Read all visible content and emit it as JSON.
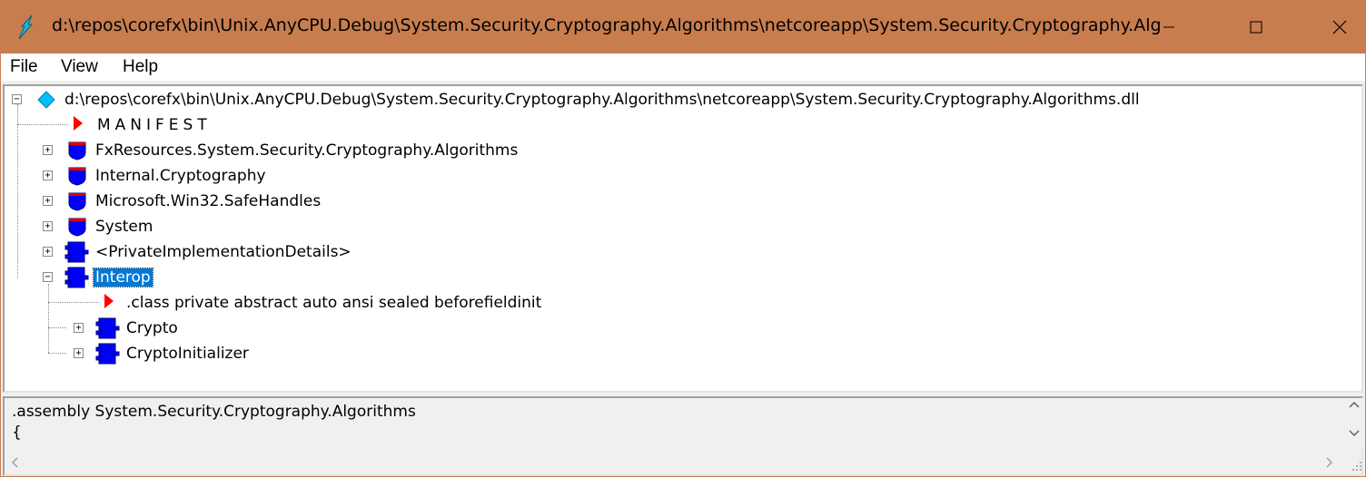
{
  "window": {
    "title": "d:\\repos\\corefx\\bin\\Unix.AnyCPU.Debug\\System.Security.Cryptography.Algorithms\\netcoreapp\\System.Security.Cryptography.Alg..."
  },
  "menu": {
    "file": "File",
    "view": "View",
    "help": "Help"
  },
  "tree": {
    "root": "d:\\repos\\corefx\\bin\\Unix.AnyCPU.Debug\\System.Security.Cryptography.Algorithms\\netcoreapp\\System.Security.Cryptography.Algorithms.dll",
    "manifest": "MANIFEST",
    "nodes": [
      "FxResources.System.Security.Cryptography.Algorithms",
      "Internal.Cryptography",
      "Microsoft.Win32.SafeHandles",
      "System",
      "<PrivateImplementationDetails>",
      "Interop"
    ],
    "interop_children": {
      "class_decl": ".class private abstract auto ansi sealed beforefieldinit",
      "crypto": "Crypto",
      "crypto_initializer": "CryptoInitializer"
    }
  },
  "details": {
    "text": ".assembly System.Security.Cryptography.Algorithms\n{"
  },
  "colors": {
    "titlebar": "#c87d4e",
    "selection": "#0078d7",
    "namespace_icon": "#0000ff",
    "manifest_icon": "#ff0000",
    "assembly_icon": "#00bfff"
  }
}
